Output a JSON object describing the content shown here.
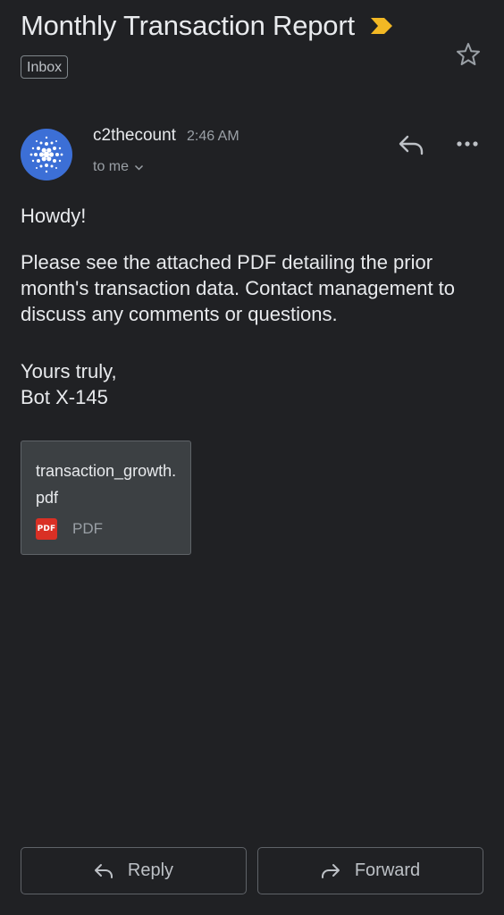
{
  "email": {
    "subject": "Monthly Transaction Report",
    "label": "Inbox",
    "sender_name": "c2thecount",
    "time": "2:46 AM",
    "recipient": "to me",
    "greeting": "Howdy!",
    "paragraph": "Please see the attached PDF detailing the prior month's transaction data. Contact management to discuss any comments or questions.",
    "signoff_line1": "Yours truly,",
    "signoff_line2": "Bot X-145"
  },
  "attachment": {
    "filename": "transaction_growth.pdf",
    "type_badge": "PDF",
    "type_label": "PDF"
  },
  "actions": {
    "reply_label": "Reply",
    "forward_label": "Forward"
  },
  "icons": {
    "importance": "importance-marker-icon",
    "star": "star-icon",
    "reply": "reply-icon",
    "more": "more-options-icon",
    "forward": "forward-icon",
    "chevron": "chevron-down-icon",
    "pdf": "pdf-file-icon"
  },
  "colors": {
    "background": "#202124",
    "importance_marker": "#f2b824",
    "avatar": "#3c6fd6",
    "pdf_badge": "#d93025"
  }
}
